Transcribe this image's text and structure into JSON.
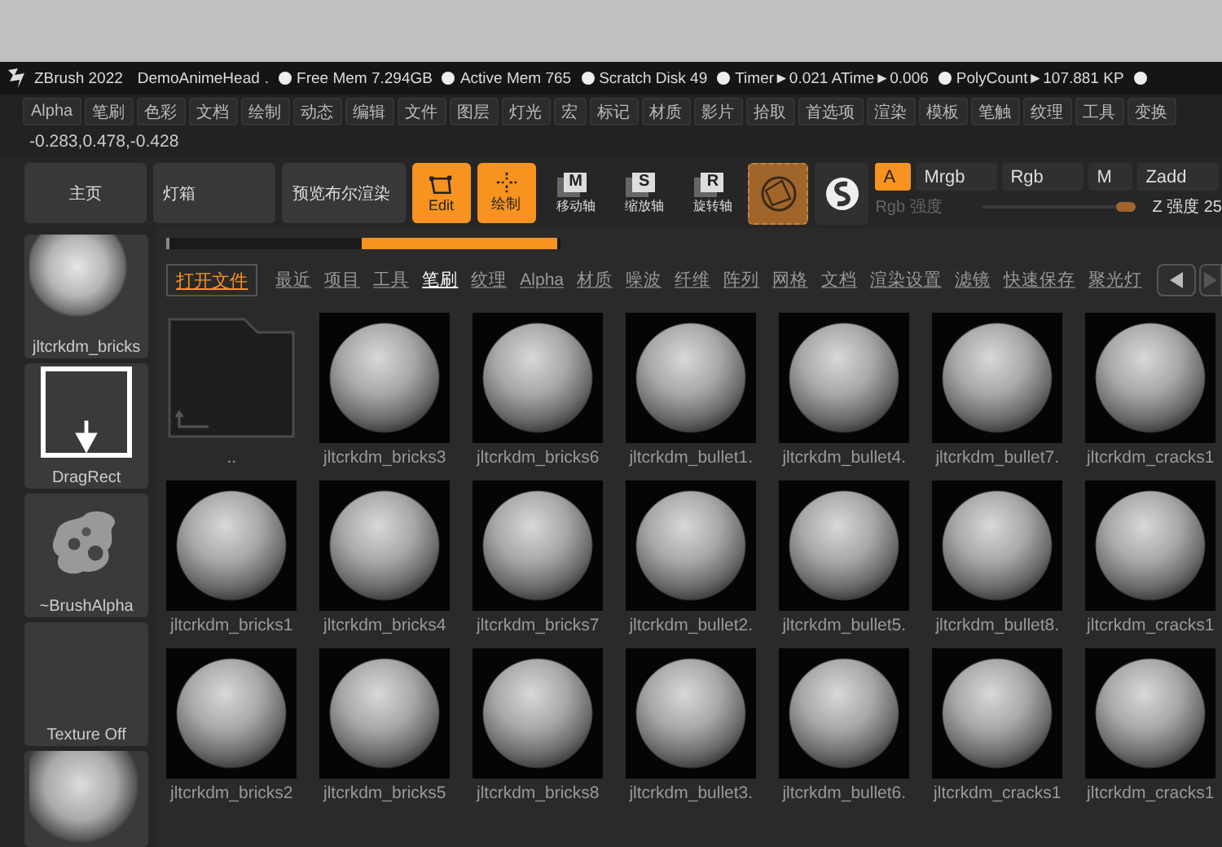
{
  "title_bar": {
    "app": "ZBrush 2022",
    "document": "DemoAnimeHead",
    "separator": ".",
    "stats": [
      "Free Mem 7.294GB",
      "Active Mem 765",
      "Scratch Disk 49",
      "Timer►0.021 ATime►0.006",
      "PolyCount►107.881 KP"
    ]
  },
  "menu": [
    "Alpha",
    "笔刷",
    "色彩",
    "文档",
    "绘制",
    "动态",
    "编辑",
    "文件",
    "图层",
    "灯光",
    "宏",
    "标记",
    "材质",
    "影片",
    "拾取",
    "首选项",
    "渲染",
    "模板",
    "笔触",
    "纹理",
    "工具",
    "变换"
  ],
  "coordinates": "-0.283,0.478,-0.428",
  "toolbar": {
    "nav_buttons": [
      "主页",
      "灯箱",
      "预览布尔渲染"
    ],
    "mode_buttons": [
      {
        "label": "Edit",
        "kind": "edit",
        "on": true
      },
      {
        "label": "绘制",
        "kind": "draw",
        "on": true
      }
    ],
    "axis_buttons": [
      {
        "letter": "M",
        "label": "移动轴"
      },
      {
        "letter": "S",
        "label": "缩放轴"
      },
      {
        "letter": "R",
        "label": "旋转轴"
      }
    ],
    "channels": [
      {
        "label": "A",
        "selected": true
      },
      {
        "label": "Mrgb",
        "selected": false
      },
      {
        "label": "Rgb",
        "selected": false
      },
      {
        "label": "M",
        "selected": false
      },
      {
        "label": "Zadd",
        "selected": false
      }
    ],
    "rgb_intensity": {
      "label": "Rgb 强度",
      "level": 1.0,
      "disabled": true
    },
    "z_intensity": {
      "label": "Z 强度 25"
    }
  },
  "sidebar": {
    "slots": [
      {
        "label": "jltcrkdm_bricks",
        "kind": "sphere"
      },
      {
        "label": "DragRect",
        "kind": "dragrect"
      },
      {
        "label": "~BrushAlpha",
        "kind": "alpha"
      },
      {
        "label": "Texture Off",
        "kind": "empty"
      },
      {
        "kind": "plain"
      }
    ]
  },
  "browser": {
    "open_button": "打开文件",
    "tabs": [
      {
        "label": "最近",
        "selected": false
      },
      {
        "label": "项目",
        "selected": false
      },
      {
        "label": "工具",
        "selected": false
      },
      {
        "label": "笔刷",
        "selected": true
      },
      {
        "label": "纹理",
        "selected": false
      },
      {
        "label": "Alpha",
        "selected": false
      },
      {
        "label": "材质",
        "selected": false
      },
      {
        "label": "噪波",
        "selected": false
      },
      {
        "label": "纤维",
        "selected": false
      },
      {
        "label": "阵列",
        "selected": false
      },
      {
        "label": "网格",
        "selected": false
      },
      {
        "label": "文档",
        "selected": false
      },
      {
        "label": "渲染设置",
        "selected": false
      },
      {
        "label": "滤镜",
        "selected": false
      },
      {
        "label": "快速保存",
        "selected": false
      },
      {
        "label": "聚光灯",
        "selected": false
      }
    ],
    "items": [
      {
        "label": "..",
        "kind": "folder"
      },
      {
        "label": "jltcrkdm_bricks3",
        "kind": "sphere"
      },
      {
        "label": "jltcrkdm_bricks6",
        "kind": "sphere"
      },
      {
        "label": "jltcrkdm_bullet1.",
        "kind": "sphere"
      },
      {
        "label": "jltcrkdm_bullet4.",
        "kind": "sphere"
      },
      {
        "label": "jltcrkdm_bullet7.",
        "kind": "sphere"
      },
      {
        "label": "jltcrkdm_cracks1",
        "kind": "sphere"
      },
      {
        "label": "jltcrkdm_bricks1",
        "kind": "sphere"
      },
      {
        "label": "jltcrkdm_bricks4",
        "kind": "sphere"
      },
      {
        "label": "jltcrkdm_bricks7",
        "kind": "sphere"
      },
      {
        "label": "jltcrkdm_bullet2.",
        "kind": "sphere"
      },
      {
        "label": "jltcrkdm_bullet5.",
        "kind": "sphere"
      },
      {
        "label": "jltcrkdm_bullet8.",
        "kind": "sphere"
      },
      {
        "label": "jltcrkdm_cracks1",
        "kind": "sphere"
      },
      {
        "label": "jltcrkdm_bricks2",
        "kind": "sphere"
      },
      {
        "label": "jltcrkdm_bricks5",
        "kind": "sphere"
      },
      {
        "label": "jltcrkdm_bricks8",
        "kind": "sphere"
      },
      {
        "label": "jltcrkdm_bullet3.",
        "kind": "sphere"
      },
      {
        "label": "jltcrkdm_bullet6.",
        "kind": "sphere"
      },
      {
        "label": "jltcrkdm_cracks1",
        "kind": "sphere"
      },
      {
        "label": "jltcrkdm_cracks1",
        "kind": "sphere"
      }
    ]
  }
}
